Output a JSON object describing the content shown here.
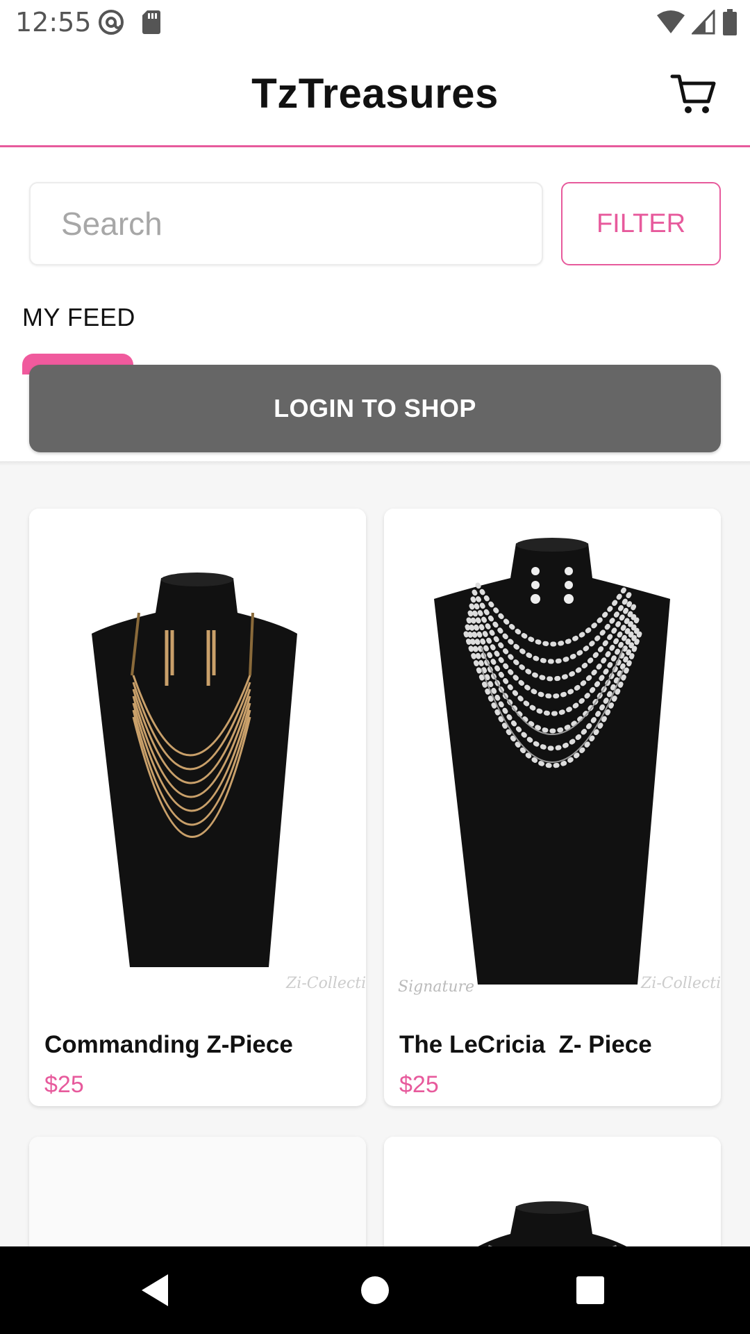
{
  "status_bar": {
    "time": "12:55",
    "icons": [
      "at-sign-icon",
      "sd-card-icon",
      "wifi-icon",
      "signal-icon",
      "battery-icon"
    ]
  },
  "header": {
    "title": "TzTreasures",
    "cart_icon": "cart-icon"
  },
  "search": {
    "placeholder": "Search",
    "value": ""
  },
  "filter": {
    "label": "FILTER"
  },
  "tabs": [
    {
      "label": "MY FEED",
      "active": true
    }
  ],
  "login": {
    "label": "LOGIN TO SHOP"
  },
  "products": [
    {
      "name": "Commanding Z-Piece",
      "price": "$25",
      "image": "gold-layered-necklace-on-black-bust"
    },
    {
      "name": "The LeCricia  Z- Piece",
      "price": "$25",
      "image": "pearl-layered-necklace-on-black-bust"
    },
    {
      "name": "",
      "price": "",
      "image": "blank"
    },
    {
      "name": "",
      "price": "",
      "image": "necklace-on-black-bust"
    }
  ],
  "nav_bar": {
    "icons": [
      "back-icon",
      "home-icon",
      "recents-icon"
    ]
  },
  "colors": {
    "accent": "#e75a9c",
    "tab_indicator": "#f05a9d",
    "login_button": "#666666",
    "background": "#f6f6f6"
  }
}
